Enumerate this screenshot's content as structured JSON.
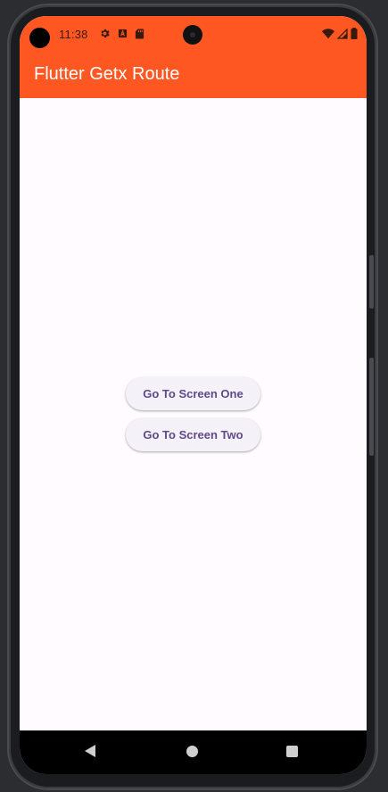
{
  "status_bar": {
    "time": "11:38",
    "left_icons": [
      "gear-icon",
      "keyboard-a-icon",
      "sd-card-icon"
    ],
    "right_icons": [
      "wifi-icon",
      "signal-icon",
      "battery-icon"
    ],
    "background": "#ff5722"
  },
  "app_bar": {
    "title": "Flutter Getx Route",
    "background": "#ff5722",
    "title_color": "#ffffff"
  },
  "main": {
    "buttons": [
      {
        "label": "Go To Screen One"
      },
      {
        "label": "Go To Screen Two"
      }
    ],
    "button_text_color": "#5b4b8a",
    "background": "#fffbfe"
  },
  "nav_bar": {
    "items": [
      "back-icon",
      "home-icon",
      "recents-icon"
    ]
  }
}
